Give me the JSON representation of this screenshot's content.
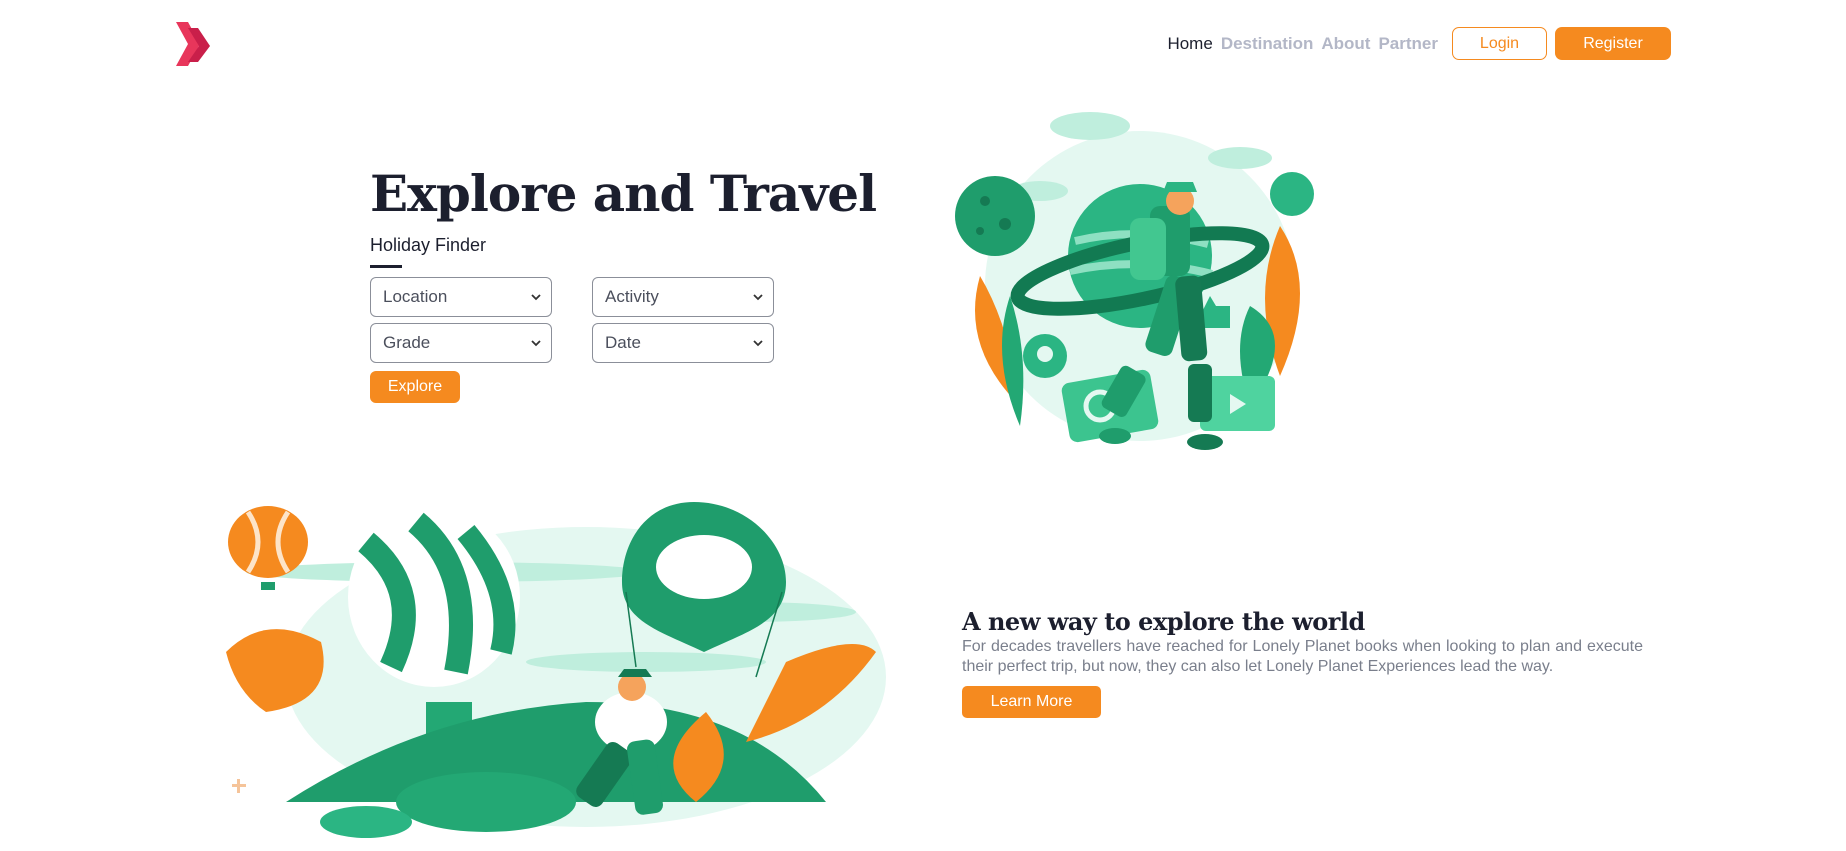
{
  "header": {
    "logo": "chevron-logo-icon",
    "nav": [
      {
        "label": "Home",
        "state": "active"
      },
      {
        "label": "Destination",
        "state": "muted"
      },
      {
        "label": "About",
        "state": "muted"
      },
      {
        "label": "Partner",
        "state": "muted"
      }
    ],
    "login_label": "Login",
    "register_label": "Register"
  },
  "hero": {
    "title": "Explore and Travel",
    "finder_title": "Holiday Finder",
    "selects": {
      "location": "Location",
      "activity": "Activity",
      "grade": "Grade",
      "date": "Date"
    },
    "explore_label": "Explore",
    "illustration": "traveler-planet-illustration"
  },
  "section2": {
    "title": "A new way to explore the world",
    "text": "For decades travellers have reached for Lonely Planet books when looking to plan and execute their perfect trip, but now, they can also let Lonely Planet Experiences lead the way.",
    "button_label": "Learn More",
    "illustration": "balloon-travel-illustration"
  },
  "colors": {
    "accent": "#f58a1f",
    "text_dark": "#1c1f2e",
    "nav_muted": "#b3b7c7",
    "green": "#1fa878",
    "logo": "#e8365b"
  }
}
